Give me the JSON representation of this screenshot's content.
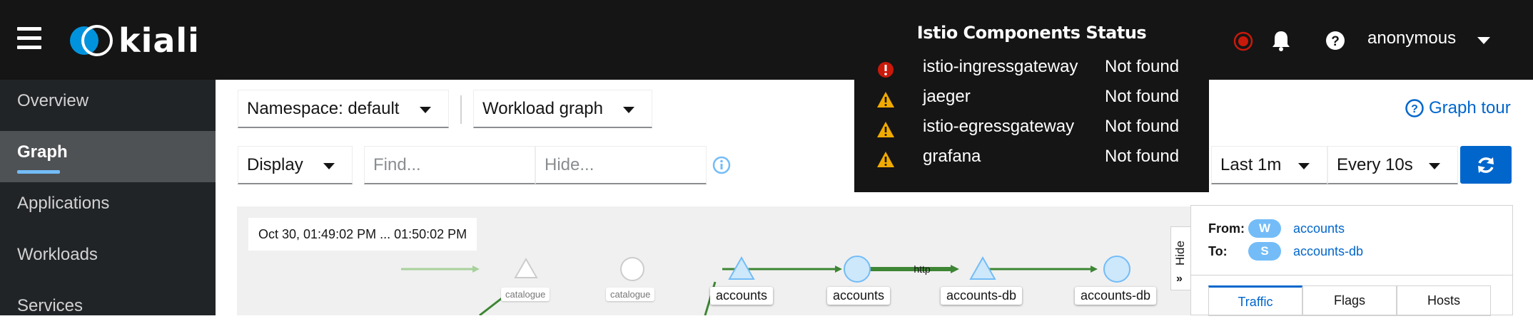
{
  "masthead": {
    "logo_text": "kiali",
    "user": "anonymous",
    "icons": [
      "hamburger-menu-icon",
      "kiali-logo",
      "error-status-icon",
      "bell-icon",
      "help-icon",
      "user-dropdown-caret-icon"
    ]
  },
  "sidebar": {
    "items": [
      {
        "label": "Overview"
      },
      {
        "label": "Graph"
      },
      {
        "label": "Applications"
      },
      {
        "label": "Workloads"
      },
      {
        "label": "Services"
      }
    ],
    "active": "Graph"
  },
  "toolbar": {
    "namespace": "Namespace: default",
    "graph_type": "Workload graph",
    "display": "Display",
    "find_placeholder": "Find...",
    "hide_placeholder": "Hide...",
    "duration": "Last 1m",
    "refresh_interval": "Every 10s",
    "graph_tour": "Graph tour"
  },
  "graph": {
    "timestamp": "Oct 30, 01:49:02 PM ... 01:50:02 PM",
    "nodes": [
      {
        "label": "catalogue",
        "shape": "triangle",
        "faded": true
      },
      {
        "label": "catalogue",
        "shape": "circle",
        "faded": true
      },
      {
        "label": "accounts",
        "shape": "triangle"
      },
      {
        "label": "accounts",
        "shape": "circle"
      },
      {
        "label": "accounts-db",
        "shape": "triangle"
      },
      {
        "label": "accounts-db",
        "shape": "circle"
      }
    ],
    "edge_label": "http",
    "hide_label": "Hide"
  },
  "side_panel": {
    "from_label": "From:",
    "from_badge": "W",
    "from_value": "accounts",
    "to_label": "To:",
    "to_badge": "S",
    "to_value": "accounts-db",
    "tabs": [
      "Traffic",
      "Flags",
      "Hosts"
    ],
    "active_tab": "Traffic"
  },
  "popover": {
    "title": "Istio Components Status",
    "components": [
      {
        "name": "istio-ingressgateway",
        "status": "Not found",
        "severity": "error"
      },
      {
        "name": "jaeger",
        "status": "Not found",
        "severity": "warning"
      },
      {
        "name": "istio-egressgateway",
        "status": "Not found",
        "severity": "warning"
      },
      {
        "name": "grafana",
        "status": "Not found",
        "severity": "warning"
      }
    ]
  },
  "colors": {
    "masthead_bg": "#151515",
    "sidebar_bg": "#212427",
    "accent": "#0066cc",
    "error": "#c9190b",
    "warning": "#f0ab00",
    "edge_green": "#3e8635",
    "node_blue": "#73bcf7"
  }
}
